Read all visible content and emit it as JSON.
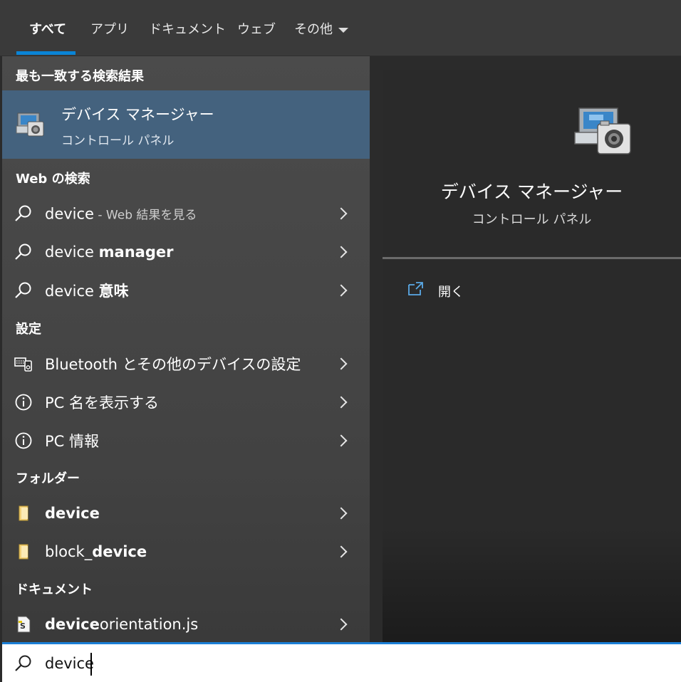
{
  "tabs": {
    "all": "すべて",
    "apps": "アプリ",
    "documents": "ドキュメント",
    "web": "ウェブ",
    "more": "その他"
  },
  "best_match": {
    "header": "最も一致する検索結果",
    "title": "デバイス マネージャー",
    "subtitle": "コントロール パネル",
    "icon": "device-manager-icon"
  },
  "web_search": {
    "header": "Web の検索",
    "items": [
      {
        "prefix": "device",
        "bold": "",
        "suffix": " - Web 結果を見る"
      },
      {
        "prefix": "device ",
        "bold": "manager",
        "suffix": ""
      },
      {
        "prefix": "device ",
        "bold": "意味",
        "suffix": ""
      }
    ]
  },
  "settings": {
    "header": "設定",
    "items": [
      {
        "label": "Bluetooth とその他のデバイスの設定",
        "icon": "devices-icon"
      },
      {
        "label": "PC 名を表示する",
        "icon": "info-icon"
      },
      {
        "label": "PC 情報",
        "icon": "info-icon"
      }
    ]
  },
  "folders": {
    "header": "フォルダー",
    "items": [
      {
        "prefix": "",
        "bold": "device",
        "suffix": ""
      },
      {
        "prefix": "block_",
        "bold": "device",
        "suffix": ""
      }
    ]
  },
  "documents": {
    "header": "ドキュメント",
    "items": [
      {
        "prefix": "",
        "bold": "device",
        "suffix": "orientation.js"
      }
    ]
  },
  "preview": {
    "title": "デバイス マネージャー",
    "subtitle": "コントロール パネル",
    "open_label": "開く"
  },
  "search": {
    "value": "device"
  },
  "colors": {
    "accent": "#0a84d6",
    "selected_bg": "#44627e"
  }
}
